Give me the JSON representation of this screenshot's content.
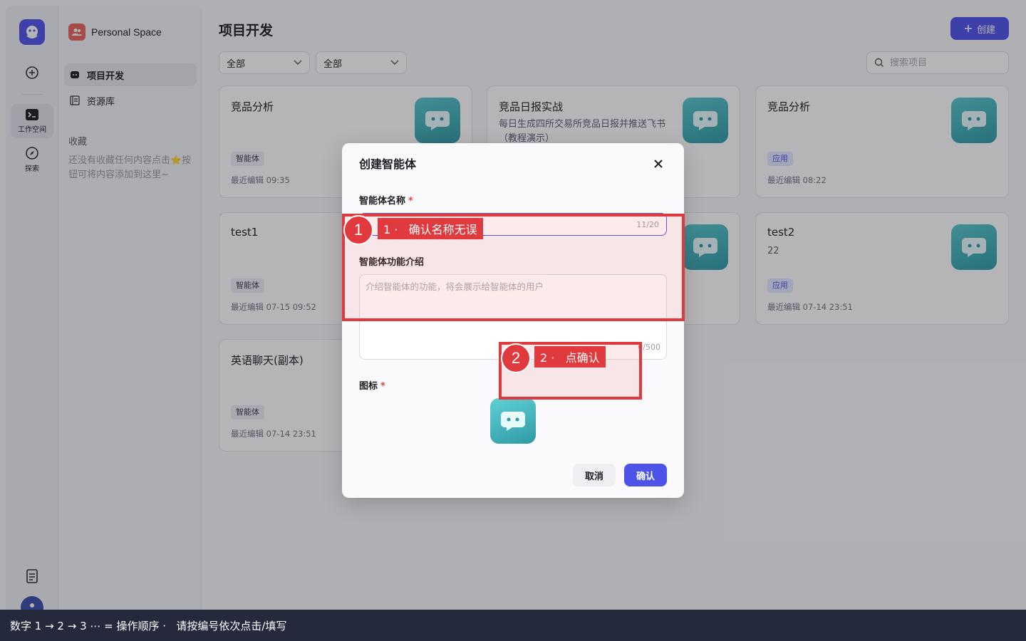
{
  "sidebar": {
    "workspace_label": "工作空间",
    "explore_label": "探索"
  },
  "secondary": {
    "space_name": "Personal Space",
    "nav": [
      {
        "label": "项目开发"
      },
      {
        "label": "资源库"
      }
    ],
    "favorites_title": "收藏",
    "favorites_empty": "还没有收藏任何内容点击⭐按钮可将内容添加到这里~"
  },
  "main": {
    "title": "项目开发",
    "create_label": "创建",
    "filter1": "全部",
    "filter2": "全部",
    "search_placeholder": "搜索项目"
  },
  "cards": [
    {
      "title": "竞品分析",
      "desc": "",
      "tag": "智能体",
      "tag_kind": "agent",
      "time": "最近编辑 09:35"
    },
    {
      "title": "竞品日报实战",
      "desc": "每日生成四所交易所竞品日报并推送飞书（教程演示）",
      "tag": "",
      "tag_kind": "",
      "time": ""
    },
    {
      "title": "竞品分析",
      "desc": "",
      "tag": "应用",
      "tag_kind": "app",
      "time": "最近编辑 08:22"
    },
    {
      "title": "test1",
      "desc": "",
      "tag": "智能体",
      "tag_kind": "agent",
      "time": "最近编辑 07-15 09:52"
    },
    {
      "title": "",
      "desc": "",
      "tag": "",
      "tag_kind": "",
      "time": ""
    },
    {
      "title": "test2",
      "desc": "22",
      "tag": "应用",
      "tag_kind": "app",
      "time": "最近编辑 07-14 23:51"
    },
    {
      "title": "英语聊天(副本)",
      "desc": "",
      "tag": "智能体",
      "tag_kind": "agent",
      "time": "最近编辑 07-14 23:51"
    }
  ],
  "modal": {
    "title": "创建智能体",
    "name_label": "智能体名称",
    "name_required": "*",
    "name_counter": "11/20",
    "desc_label": "智能体功能介绍",
    "desc_placeholder": "介绍智能体的功能，将会展示给智能体的用户",
    "desc_counter": "0/500",
    "icon_label": "图标",
    "icon_required": "*",
    "cancel_label": "取消",
    "confirm_label": "确认"
  },
  "annotations": [
    {
      "num": "1",
      "text": "1 ·   确认名称无误"
    },
    {
      "num": "2",
      "text": "2 ·   点确认"
    }
  ],
  "footer": {
    "instruction": "数字 1 → 2 → 3 ⋯ = 操作顺序 ·   请按编号依次点击/填写"
  },
  "colors": {
    "accent": "#4d53e8",
    "annotation": "#e03a3e",
    "bot_icon": "#3fb1b8"
  }
}
